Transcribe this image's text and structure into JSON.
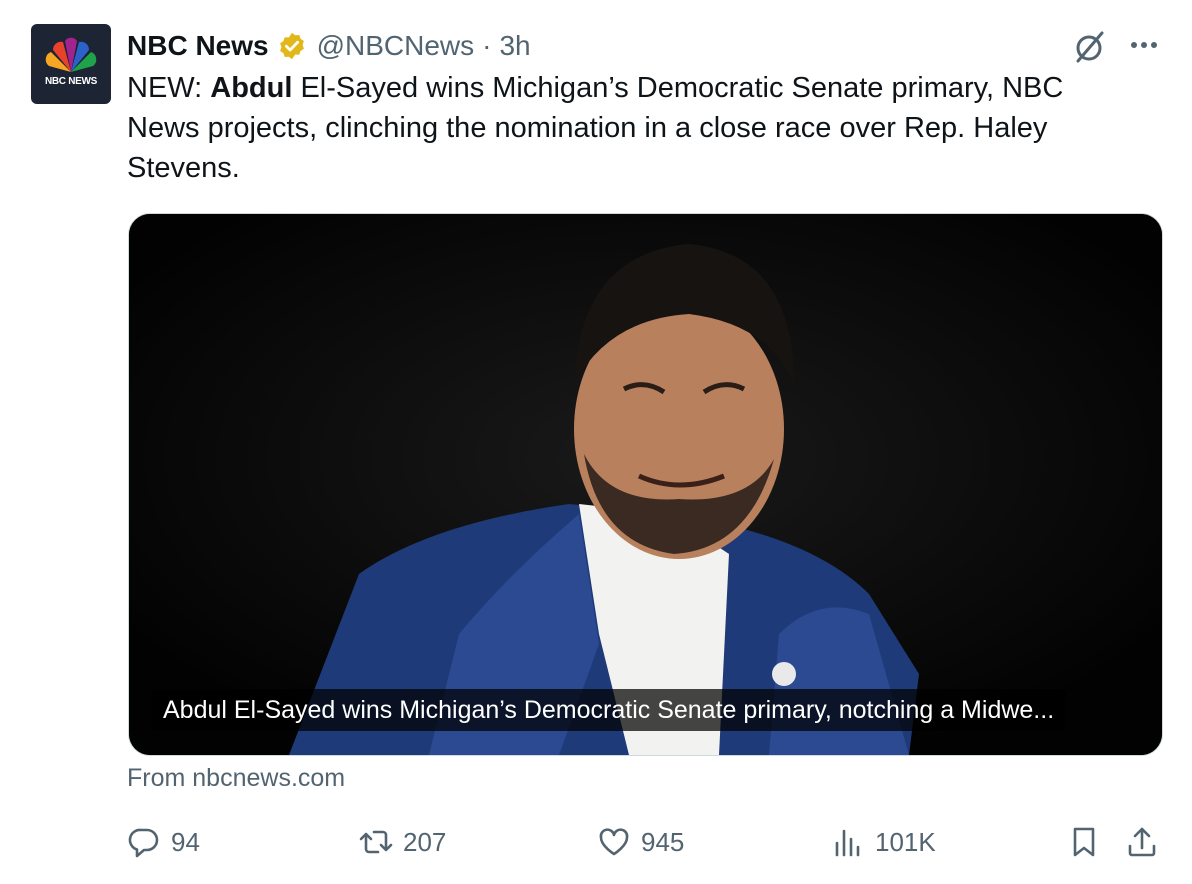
{
  "account": {
    "name": "NBC News",
    "handle": "@NBCNews",
    "separator": "·",
    "time": "3h",
    "avatar_label": "NBC NEWS",
    "verified_color": "#e2b719"
  },
  "tweet": {
    "prefix": "NEW: ",
    "bold": "Abdul",
    "rest": " El-Sayed wins Michigan’s Democratic Senate primary, NBC News projects, clinching the nomination in a close race over Rep. Haley Stevens."
  },
  "card": {
    "caption": "Abdul El-Sayed wins Michigan’s Democratic Senate primary, notching a Midwe...",
    "source": "From nbcnews.com"
  },
  "actions": {
    "replies": "94",
    "reposts": "207",
    "likes": "945",
    "views": "101K"
  },
  "icons": {
    "verified": "verified-badge-icon",
    "grok": "grok-icon",
    "more": "more-icon",
    "reply": "reply-icon",
    "repost": "repost-icon",
    "like": "heart-icon",
    "views": "views-icon",
    "bookmark": "bookmark-icon",
    "share": "share-icon"
  },
  "colors": {
    "text": "#0f1419",
    "secondary": "#536471",
    "border": "#cfd9de"
  }
}
